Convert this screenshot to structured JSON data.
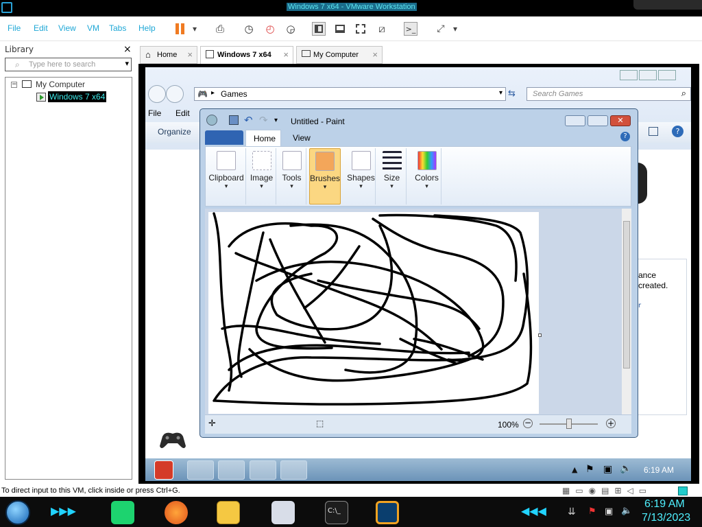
{
  "window": {
    "title": "Windows 7 x64 - VMware Workstation"
  },
  "menu": {
    "items": [
      "File",
      "Edit",
      "View",
      "VM",
      "Tabs",
      "Help"
    ]
  },
  "library": {
    "title": "Library",
    "close": "×",
    "search_placeholder": "Type here to search",
    "tree": {
      "root": "My Computer",
      "child": "Windows 7 x64",
      "expander": "−"
    }
  },
  "tabs": [
    {
      "label": "Home"
    },
    {
      "label": "Windows 7 x64",
      "active": true
    },
    {
      "label": "My Computer"
    }
  ],
  "tab_close": "×",
  "explorer": {
    "address": "Games",
    "search_placeholder": "Search Games",
    "menu": [
      "File",
      "Edit"
    ],
    "organize": "Organize",
    "side_text": [
      "ance",
      "created.",
      "r"
    ]
  },
  "paint": {
    "title": "Untitled - Paint",
    "tabs": [
      "Home",
      "View"
    ],
    "groups": [
      "Clipboard",
      "Image",
      "Tools",
      "Brushes",
      "Shapes",
      "Size",
      "Colors"
    ],
    "active_group": "Brushes",
    "zoom": "100%"
  },
  "guest_taskbar": {
    "time": "6:19 AM"
  },
  "status_message": "To direct input to this VM, click inside or press Ctrl+G.",
  "host_taskbar": {
    "time": "6:19 AM",
    "date": "7/13/2023"
  },
  "colors": {
    "accent": "#1ea7d6",
    "pause": "#f07b22",
    "clock": "#4ff0ff"
  }
}
